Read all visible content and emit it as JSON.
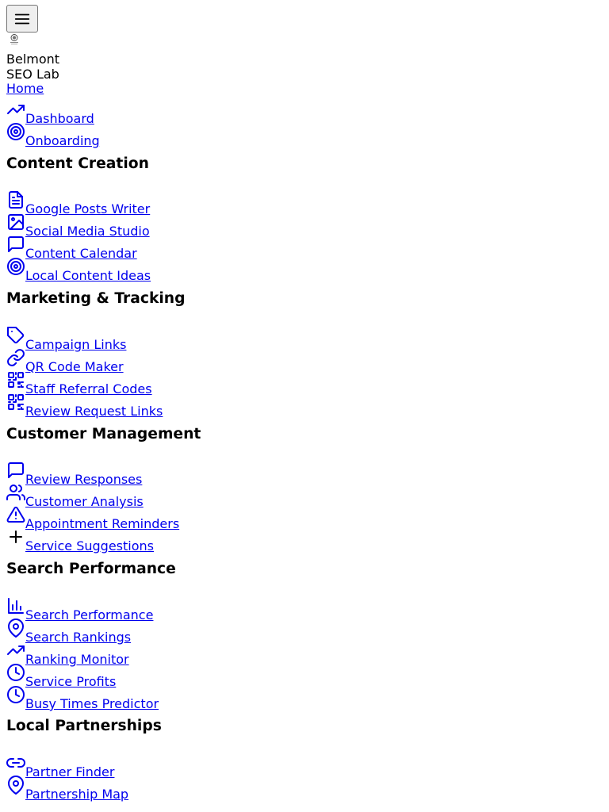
{
  "header": {
    "menu_icon": "hamburger-menu-icon",
    "logo_icon": "brand-logo-badge",
    "brand_line1": "Belmont",
    "brand_line2": "SEO Lab",
    "home_label": "Home"
  },
  "nav_top": {
    "dashboard": {
      "label": "Dashboard",
      "icon": "trending-up-icon"
    },
    "onboarding": {
      "label": "Onboarding",
      "icon": "target-icon"
    }
  },
  "content_creation": {
    "title": "Content Creation",
    "google_posts": {
      "label": "Google Posts Writer",
      "icon": "document-icon"
    },
    "social_media": {
      "label": "Social Media Studio",
      "icon": "image-icon"
    },
    "content_calendar": {
      "label": "Content Calendar",
      "icon": "message-square-icon"
    },
    "local_ideas": {
      "label": "Local Content Ideas",
      "icon": "target-icon"
    }
  },
  "marketing": {
    "title": "Marketing & Tracking",
    "campaign_links": {
      "label": "Campaign Links",
      "icon": "tag-icon"
    },
    "qr_code": {
      "label": "QR Code Maker",
      "icon": "link-icon"
    },
    "staff_referral": {
      "label": "Staff Referral Codes",
      "icon": "qr-code-icon"
    },
    "review_request": {
      "label": "Review Request Links",
      "icon": "qr-code-icon"
    }
  },
  "customer": {
    "title": "Customer Management",
    "review_responses": {
      "label": "Review Responses",
      "icon": "message-square-icon"
    },
    "customer_analysis": {
      "label": "Customer Analysis",
      "icon": "users-icon"
    },
    "appointment_reminders": {
      "label": "Appointment Reminders",
      "icon": "alert-triangle-icon"
    },
    "service_suggestions": {
      "label": "Service Suggestions",
      "icon": "plus-icon"
    }
  },
  "search": {
    "title": "Search Performance",
    "search_performance": {
      "label": "Search Performance",
      "icon": "bar-chart-icon"
    },
    "search_rankings": {
      "label": "Search Rankings",
      "icon": "map-pin-icon"
    },
    "ranking_monitor": {
      "label": "Ranking Monitor",
      "icon": "trending-up-icon"
    },
    "service_profits": {
      "label": "Service Profits",
      "icon": "clock-icon"
    },
    "busy_times": {
      "label": "Busy Times Predictor",
      "icon": "clock-icon"
    }
  },
  "partnerships": {
    "title": "Local Partnerships",
    "partner_finder": {
      "label": "Partner Finder",
      "icon": "link-icon"
    },
    "partnership_map": {
      "label": "Partnership Map",
      "icon": "map-pin-icon"
    }
  },
  "colors": {
    "link": "#0000ee",
    "text": "#000000",
    "button_bg": "#efefef",
    "button_border": "#767676"
  }
}
